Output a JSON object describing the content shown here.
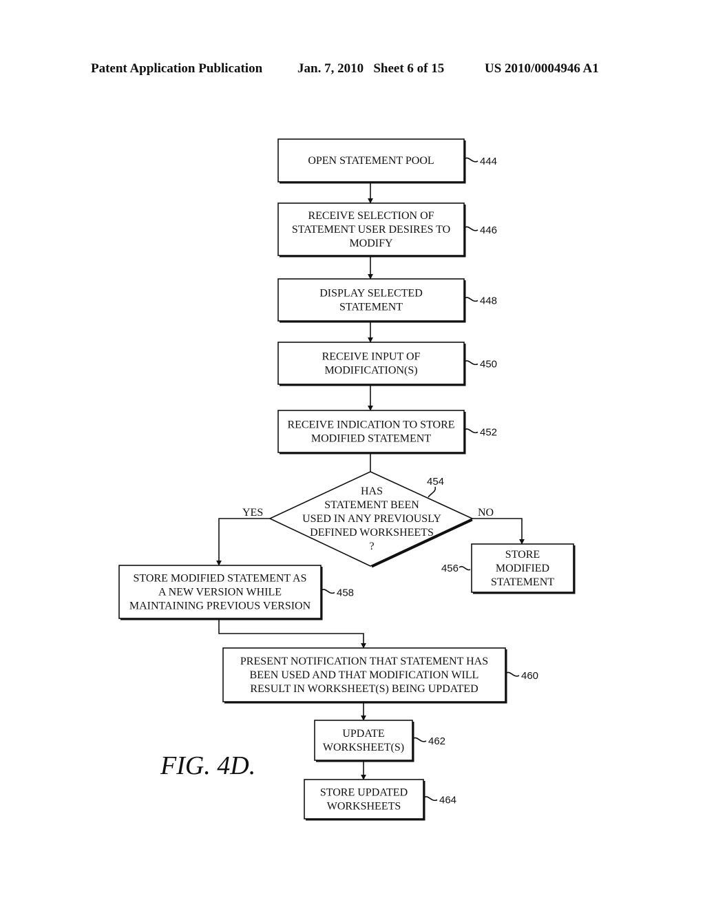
{
  "header": {
    "publication": "Patent Application Publication",
    "date_sheet": "Jan. 7, 2010   Sheet 6 of 15",
    "patent_number": "US 2010/0004946 A1"
  },
  "figure_label": "FIG. 4D.",
  "steps": {
    "s444": {
      "ref": "444",
      "lines": [
        "OPEN STATEMENT POOL"
      ]
    },
    "s446": {
      "ref": "446",
      "lines": [
        "RECEIVE SELECTION OF",
        "STATEMENT USER DESIRES TO",
        "MODIFY"
      ]
    },
    "s448": {
      "ref": "448",
      "lines": [
        "DISPLAY SELECTED",
        "STATEMENT"
      ]
    },
    "s450": {
      "ref": "450",
      "lines": [
        "RECEIVE INPUT OF",
        "MODIFICATION(S)"
      ]
    },
    "s452": {
      "ref": "452",
      "lines": [
        "RECEIVE INDICATION TO STORE",
        "MODIFIED STATEMENT"
      ]
    },
    "d454": {
      "ref": "454",
      "lines": [
        "HAS",
        "STATEMENT BEEN",
        "USED IN ANY PREVIOUSLY",
        "DEFINED WORKSHEETS",
        "?"
      ]
    },
    "s456": {
      "ref": "456",
      "lines": [
        "STORE",
        "MODIFIED",
        "STATEMENT"
      ]
    },
    "s458": {
      "ref": "458",
      "lines": [
        "STORE MODIFIED STATEMENT AS",
        "A NEW VERSION WHILE",
        "MAINTAINING PREVIOUS VERSION"
      ]
    },
    "s460": {
      "ref": "460",
      "lines": [
        "PRESENT NOTIFICATION THAT STATEMENT HAS",
        "BEEN USED AND THAT MODIFICATION WILL",
        "RESULT IN WORKSHEET(S) BEING UPDATED"
      ]
    },
    "s462": {
      "ref": "462",
      "lines": [
        "UPDATE",
        "WORKSHEET(S)"
      ]
    },
    "s464": {
      "ref": "464",
      "lines": [
        "STORE UPDATED",
        "WORKSHEETS"
      ]
    }
  },
  "branches": {
    "yes": "YES",
    "no": "NO"
  }
}
